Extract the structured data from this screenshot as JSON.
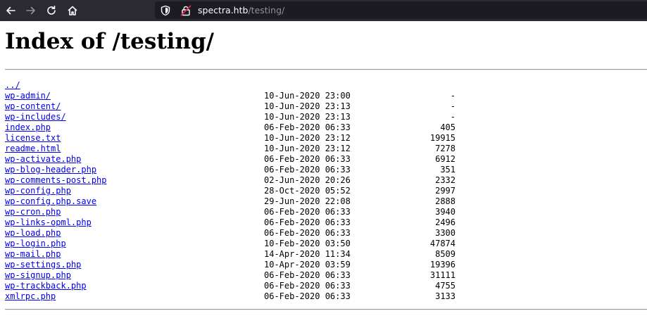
{
  "browser": {
    "url_host": "spectra.htb",
    "url_path": "/testing/"
  },
  "page": {
    "title": "Index of /testing/"
  },
  "entries": [
    {
      "name": "../",
      "date": "",
      "size": ""
    },
    {
      "name": "wp-admin/",
      "date": "10-Jun-2020 23:00",
      "size": "-"
    },
    {
      "name": "wp-content/",
      "date": "10-Jun-2020 23:13",
      "size": "-"
    },
    {
      "name": "wp-includes/",
      "date": "10-Jun-2020 23:13",
      "size": "-"
    },
    {
      "name": "index.php",
      "date": "06-Feb-2020 06:33",
      "size": "405"
    },
    {
      "name": "license.txt",
      "date": "10-Jun-2020 23:12",
      "size": "19915"
    },
    {
      "name": "readme.html",
      "date": "10-Jun-2020 23:12",
      "size": "7278"
    },
    {
      "name": "wp-activate.php",
      "date": "06-Feb-2020 06:33",
      "size": "6912"
    },
    {
      "name": "wp-blog-header.php",
      "date": "06-Feb-2020 06:33",
      "size": "351"
    },
    {
      "name": "wp-comments-post.php",
      "date": "02-Jun-2020 20:26",
      "size": "2332"
    },
    {
      "name": "wp-config.php",
      "date": "28-Oct-2020 05:52",
      "size": "2997"
    },
    {
      "name": "wp-config.php.save",
      "date": "29-Jun-2020 22:08",
      "size": "2888"
    },
    {
      "name": "wp-cron.php",
      "date": "06-Feb-2020 06:33",
      "size": "3940"
    },
    {
      "name": "wp-links-opml.php",
      "date": "06-Feb-2020 06:33",
      "size": "2496"
    },
    {
      "name": "wp-load.php",
      "date": "06-Feb-2020 06:33",
      "size": "3300"
    },
    {
      "name": "wp-login.php",
      "date": "10-Feb-2020 03:50",
      "size": "47874"
    },
    {
      "name": "wp-mail.php",
      "date": "14-Apr-2020 11:34",
      "size": "8509"
    },
    {
      "name": "wp-settings.php",
      "date": "10-Apr-2020 03:59",
      "size": "19396"
    },
    {
      "name": "wp-signup.php",
      "date": "06-Feb-2020 06:33",
      "size": "31111"
    },
    {
      "name": "wp-trackback.php",
      "date": "06-Feb-2020 06:33",
      "size": "4755"
    },
    {
      "name": "xmlrpc.php",
      "date": "06-Feb-2020 06:33",
      "size": "3133"
    }
  ]
}
